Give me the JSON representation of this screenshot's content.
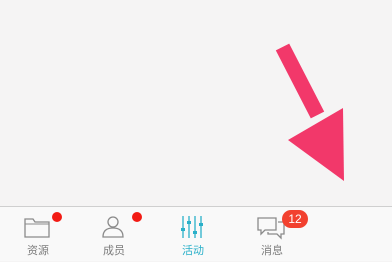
{
  "tabbar": {
    "tabs": [
      {
        "label": "资源",
        "icon": "folder-icon",
        "has_dot": true
      },
      {
        "label": "成员",
        "icon": "person-icon",
        "has_dot": true
      },
      {
        "label": "活动",
        "icon": "sliders-icon",
        "active": true
      },
      {
        "label": "消息",
        "icon": "chat-bubbles-icon",
        "badge": "12"
      }
    ]
  },
  "colors": {
    "accent": "#2ab0c9",
    "badge": "#f2412f",
    "dot": "#f21b14",
    "arrow": "#f2386a",
    "inactive_label": "#7d7d7d",
    "background": "#f5f4f4"
  }
}
